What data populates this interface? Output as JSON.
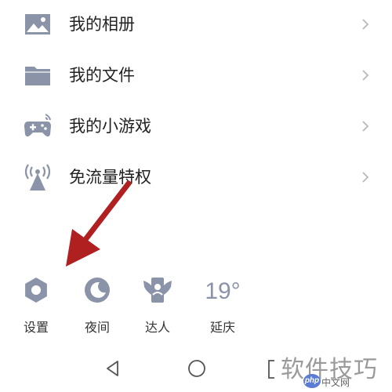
{
  "menu": {
    "items": [
      {
        "label": "我的相册",
        "icon": "image-icon"
      },
      {
        "label": "我的文件",
        "icon": "folder-icon"
      },
      {
        "label": "我的小游戏",
        "icon": "gamepad-icon"
      },
      {
        "label": "免流量特权",
        "icon": "signal-tower-icon"
      }
    ]
  },
  "quick_actions": {
    "settings": "设置",
    "night": "夜间",
    "expert": "达人",
    "weather_temp": "19°",
    "weather_city": "延庆"
  },
  "watermark": {
    "title": "软件技巧",
    "php_badge": "php",
    "site": "中文网"
  },
  "colors": {
    "icon_gray": "#8a93a8",
    "arrow_red": "#b02020",
    "text": "#222222"
  }
}
